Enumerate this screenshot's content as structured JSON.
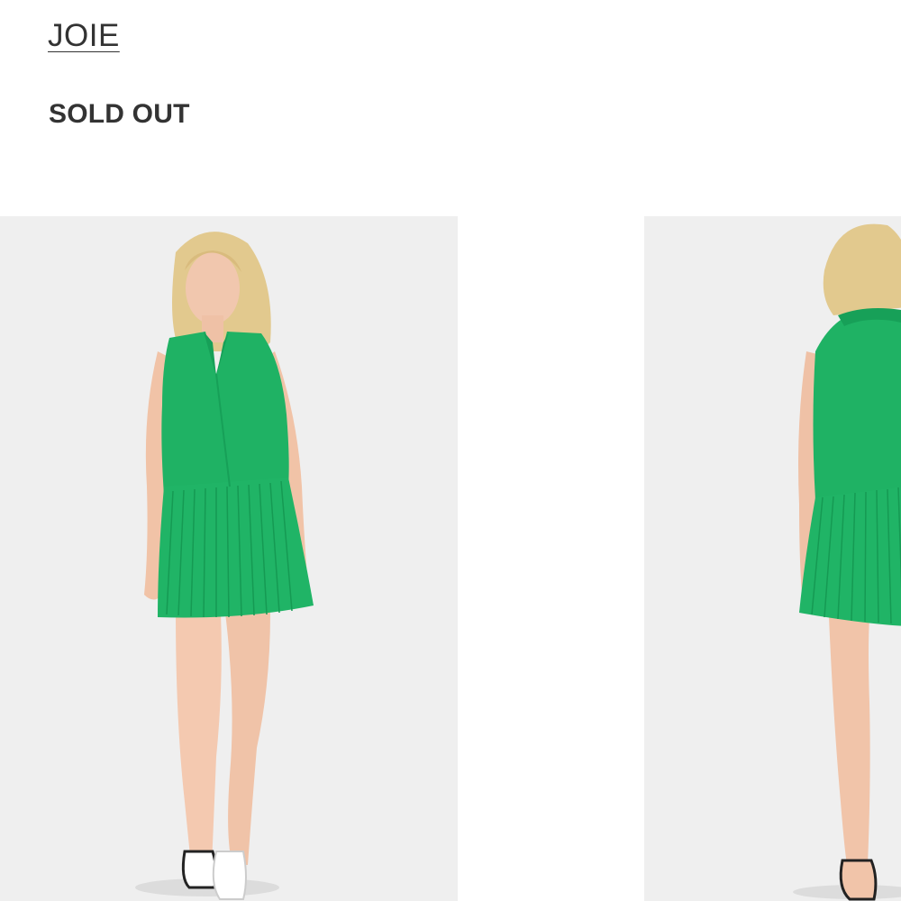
{
  "product": {
    "brand": "JOIE",
    "status": "SOLD OUT"
  },
  "gallery": {
    "images": [
      {
        "name": "front-view"
      },
      {
        "name": "back-view"
      }
    ]
  },
  "colors": {
    "dress": "#1fb264",
    "background": "#efefef",
    "text": "#333333"
  }
}
